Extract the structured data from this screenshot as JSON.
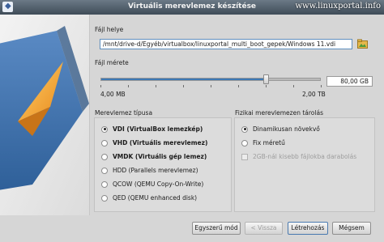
{
  "window": {
    "title": "Virtuális merevlemez készítése",
    "watermark": "www.linuxportal.info"
  },
  "file_location": {
    "label": "Fájl helye",
    "value": "/mnt/drive-d/Egyéb/virtualbox/linuxportal_multi_boot_gepek/Windows 11.vdi",
    "button_icon": "folder-icon"
  },
  "file_size": {
    "label": "Fájl mérete",
    "min_label": "4,00 MB",
    "max_label": "2,00 TB",
    "value": "80,00 GB",
    "slider_fraction": 0.75
  },
  "disk_type": {
    "label": "Merevlemez típusa",
    "options": [
      {
        "label": "VDI (VirtualBox lemezkép)",
        "selected": true,
        "bold": true
      },
      {
        "label": "VHD (Virtuális merevlemez)",
        "selected": false,
        "bold": true
      },
      {
        "label": "VMDK (Virtuális gép lemez)",
        "selected": false,
        "bold": true
      },
      {
        "label": "HDD (Parallels merevlemez)",
        "selected": false,
        "bold": false
      },
      {
        "label": "QCOW (QEMU Copy-On-Write)",
        "selected": false,
        "bold": false
      },
      {
        "label": "QED (QEMU enhanced disk)",
        "selected": false,
        "bold": false
      }
    ]
  },
  "storage": {
    "label": "Fizikai merevlemezen tárolás",
    "options": [
      {
        "label": "Dinamikusan növekvő",
        "selected": true
      },
      {
        "label": "Fix méretű",
        "selected": false
      }
    ],
    "split_label": "2GB-nál kisebb fájlokba darabolás",
    "split_checked": false
  },
  "buttons": {
    "simple_mode": "Egyszerű mód",
    "back": "< Vissza",
    "create": "Létrehozás",
    "cancel": "Mégsem"
  },
  "colors": {
    "accent": "#3c78b4",
    "graphic_blue": "#3d6fa9",
    "graphic_orange": "#f0a030"
  }
}
